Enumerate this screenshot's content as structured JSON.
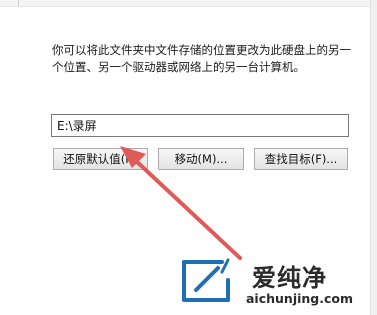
{
  "dialog": {
    "description": "你可以将此文件夹中文件存储的位置更改为此硬盘上的另一个位置、另一个驱动器或网络上的另一台计算机。",
    "path_value": "E:\\录屏",
    "buttons": {
      "restore_default": "还原默认值(R)",
      "move": "移动(M)...",
      "find_target": "查找目标(F)..."
    }
  },
  "annotation": {
    "arrow_color": "#e05a5a"
  },
  "watermark": {
    "title": "爱纯净",
    "url": "aichunjing.com"
  }
}
